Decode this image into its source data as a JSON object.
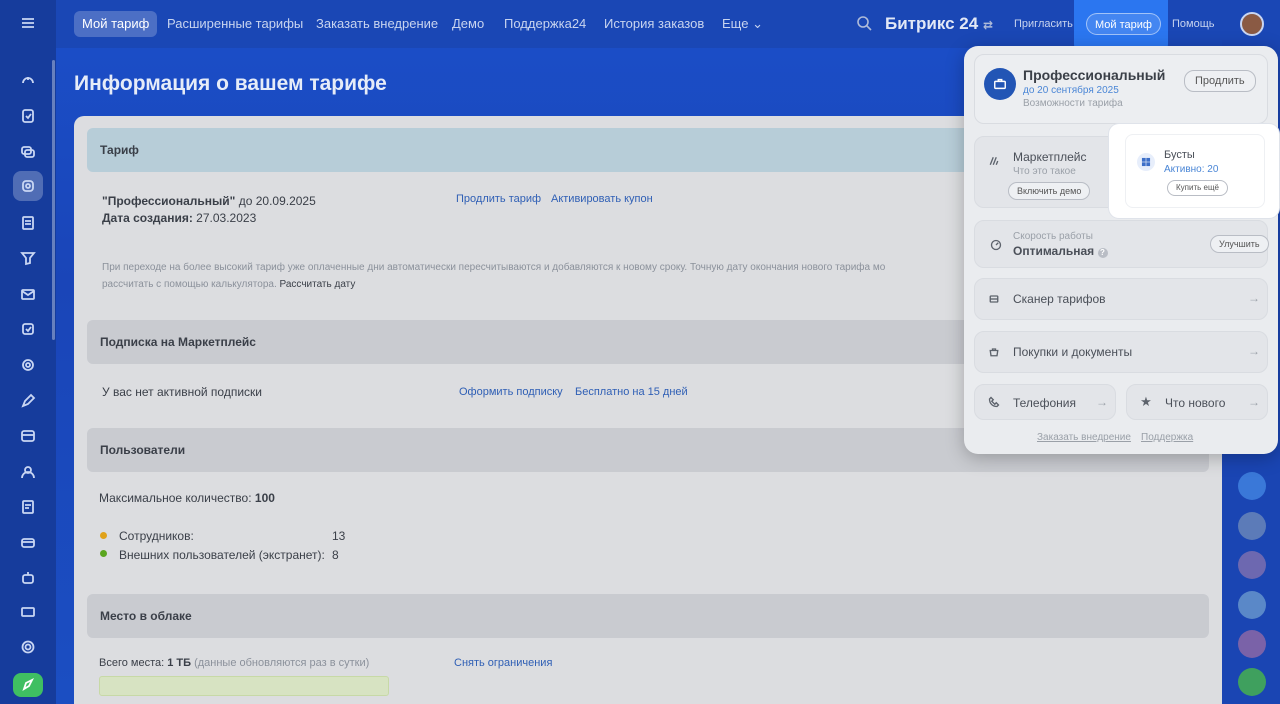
{
  "topbar": {
    "tabs": [
      "Мой тариф",
      "Расширенные тарифы",
      "Заказать внедрение",
      "Демо",
      "Поддержка24",
      "История заказов",
      "Еще"
    ],
    "brand": "Битрикс 24",
    "invite": "Пригласить",
    "my_plan": "Мой тариф",
    "help": "Помощь"
  },
  "page": {
    "title": "Информация о вашем тарифе"
  },
  "tariff": {
    "header": "Тариф",
    "name": "\"Профессиональный\"",
    "until": " до 20.09.2025",
    "created_label": "Дата создания:",
    "created_value": " 27.03.2023",
    "extend_link": "Продлить тариф",
    "coupon_link": "Активировать купон",
    "note_line1": "При переходе на более высокий тариф уже оплаченные дни автоматически пересчитываются и добавляются к новому сроку. Точную дату окончания нового тарифа мо",
    "note_line2": "рассчитать с помощью калькулятора.",
    "calc_link": " Рассчитать дату"
  },
  "marketplace": {
    "header": "Подписка на Маркетплейс",
    "status": "У вас нет активной подписки",
    "subscribe_link": "Оформить подписку",
    "free_link": "Бесплатно на 15 дней"
  },
  "users": {
    "header": "Пользователи",
    "max_label": "Максимальное количество:",
    "max_value": " 100",
    "employees_label": "Сотрудников:",
    "employees_value": "13",
    "external_label": "Внешних пользователей (экстранет):",
    "external_value": "8"
  },
  "cloud": {
    "header": "Место в облаке",
    "total_label": "Всего места:",
    "total_value": " 1 ТБ",
    "note": " (данные обновляются раз в сутки)",
    "remove_limits": "Снять ограничения"
  },
  "popup": {
    "plan_name": "Профессиональный",
    "plan_until": "до 20 сентября 2025",
    "plan_features": "Возможности тарифа",
    "extend_btn": "Продлить",
    "market_title": "Маркетплейс",
    "market_sub": "Что это такое",
    "market_btn": "Включить демо",
    "boost_title": "Бусты",
    "boost_active": "Активно: 20",
    "boost_btn": "Купить ещё",
    "speed_label": "Скорость работы",
    "speed_value": "Оптимальная",
    "speed_btn": "Улучшить",
    "scanner": "Сканер тарифов",
    "purchases": "Покупки и документы",
    "telephony": "Телефония",
    "whats_new": "Что нового",
    "footer_order": "Заказать внедрение",
    "footer_support": "Поддержка"
  },
  "colors": {
    "accent": "#2b76f0",
    "dot_employees": "#e0a21a",
    "dot_external": "#5aa51f"
  }
}
